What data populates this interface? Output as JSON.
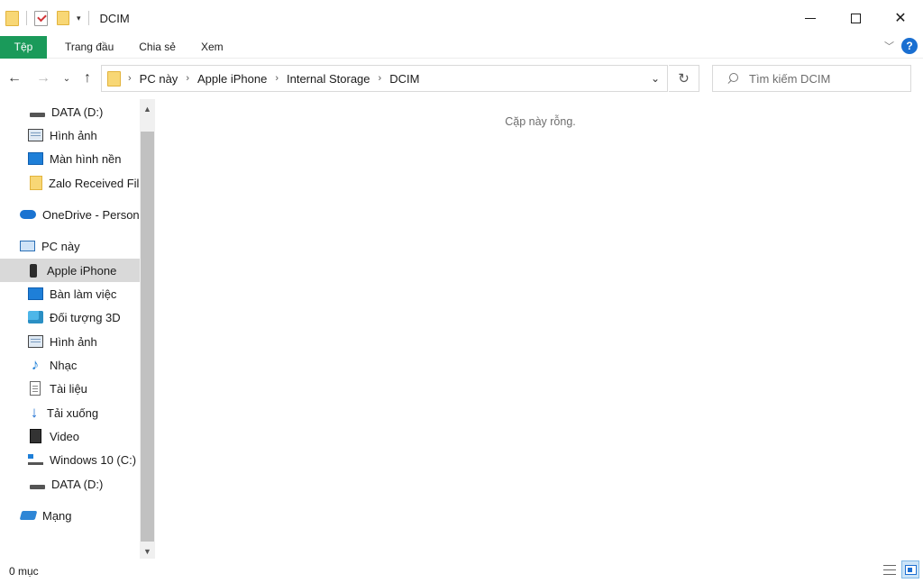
{
  "window": {
    "title": "DCIM"
  },
  "ribbon": {
    "tabs": [
      {
        "label": "Tệp"
      },
      {
        "label": "Trang đầu"
      },
      {
        "label": "Chia sẻ"
      },
      {
        "label": "Xem"
      }
    ],
    "help_label": "?"
  },
  "address": {
    "crumbs": [
      "PC này",
      "Apple iPhone",
      "Internal Storage",
      "DCIM"
    ]
  },
  "search": {
    "placeholder": "Tìm kiếm DCIM"
  },
  "nav": {
    "items": [
      {
        "label": "DATA (D:)",
        "icon": "drive-icon"
      },
      {
        "label": "Hình ảnh",
        "icon": "pictures-icon"
      },
      {
        "label": "Màn hình nền",
        "icon": "desktop-icon"
      },
      {
        "label": "Zalo Received Files",
        "icon": "folder-icon"
      },
      {
        "label": "OneDrive - Personal",
        "icon": "cloud-icon"
      },
      {
        "label": "PC này",
        "icon": "pc-icon"
      },
      {
        "label": "Apple iPhone",
        "icon": "phone-icon"
      },
      {
        "label": "Bàn làm việc",
        "icon": "desktop-icon"
      },
      {
        "label": "Đối tượng 3D",
        "icon": "3d-objects-icon"
      },
      {
        "label": "Hình ảnh",
        "icon": "pictures-icon"
      },
      {
        "label": "Nhạc",
        "icon": "music-icon"
      },
      {
        "label": "Tài liệu",
        "icon": "documents-icon"
      },
      {
        "label": "Tải xuống",
        "icon": "download-icon"
      },
      {
        "label": "Video",
        "icon": "video-icon"
      },
      {
        "label": "Windows 10 (C:)",
        "icon": "windows-drive-icon"
      },
      {
        "label": "DATA (D:)",
        "icon": "drive-icon"
      },
      {
        "label": "Mạng",
        "icon": "network-icon"
      }
    ],
    "selected": "Apple iPhone"
  },
  "content": {
    "empty_message": "Cặp này rỗng."
  },
  "status": {
    "item_count": "0 mục"
  },
  "colors": {
    "file_tab": "#1a9a5a",
    "selection": "#d9d9d9",
    "accent": "#1a6fd1"
  }
}
